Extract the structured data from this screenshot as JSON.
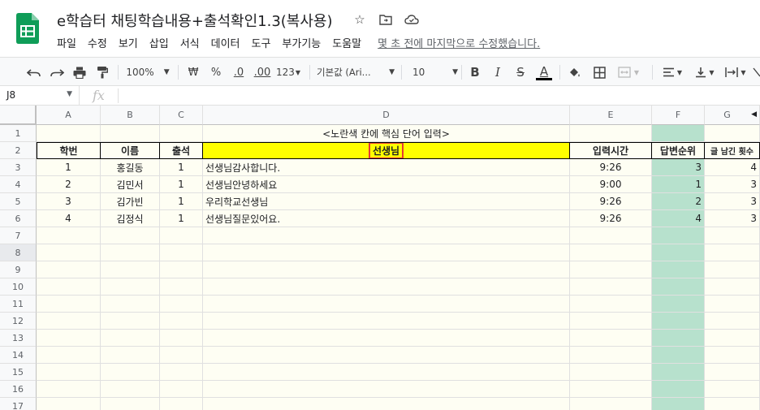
{
  "doc": {
    "title": "e학습터 채팅학습내용+출석확인1.3(복사용)",
    "menu": [
      "파일",
      "수정",
      "보기",
      "삽입",
      "서식",
      "데이터",
      "도구",
      "부가기능",
      "도움말"
    ],
    "last_edit": "몇 초 전에 마지막으로 수정했습니다."
  },
  "toolbar": {
    "zoom": "100%",
    "currency": "₩",
    "percent": "%",
    "dec_less": ".0",
    "dec_more": ".00",
    "format_more": "123",
    "font": "기본값 (Ari...",
    "font_size": "10",
    "bold": "B",
    "italic": "I",
    "strike": "S",
    "text_color": "A"
  },
  "formula": {
    "cell_ref": "J8",
    "fx": "fx",
    "value": ""
  },
  "columns": [
    "A",
    "B",
    "C",
    "D",
    "E",
    "F",
    "G"
  ],
  "rows": [
    "1",
    "2",
    "3",
    "4",
    "5",
    "6",
    "7",
    "8",
    "9",
    "10",
    "11",
    "12",
    "13",
    "14",
    "15",
    "16",
    "17"
  ],
  "sheet": {
    "banner": "<노란색 칸에 핵심 단어 입력>",
    "headers": {
      "a": "학번",
      "b": "이름",
      "c": "출석",
      "d": "선생님",
      "e": "입력시간",
      "f": "답변순위",
      "g": "글 남긴 횟수"
    },
    "data": [
      {
        "a": "1",
        "b": "홍길동",
        "c": "1",
        "d": "선생님감사합니다.",
        "e": "9:26",
        "f": "3",
        "g": "4"
      },
      {
        "a": "2",
        "b": "김민서",
        "c": "1",
        "d": "선생님안녕하세요",
        "e": "9:00",
        "f": "1",
        "g": "3"
      },
      {
        "a": "3",
        "b": "김가빈",
        "c": "1",
        "d": "우리학교선생님",
        "e": "9:26",
        "f": "2",
        "g": "3"
      },
      {
        "a": "4",
        "b": "김정식",
        "c": "1",
        "d": "선생님질문있어요.",
        "e": "9:26",
        "f": "4",
        "g": "3"
      }
    ]
  },
  "colors": {
    "sheets_green": "#0f9d58",
    "yellow": "#ffff00",
    "answer_green": "#b7e1cd",
    "highlight_red": "#e53935"
  }
}
